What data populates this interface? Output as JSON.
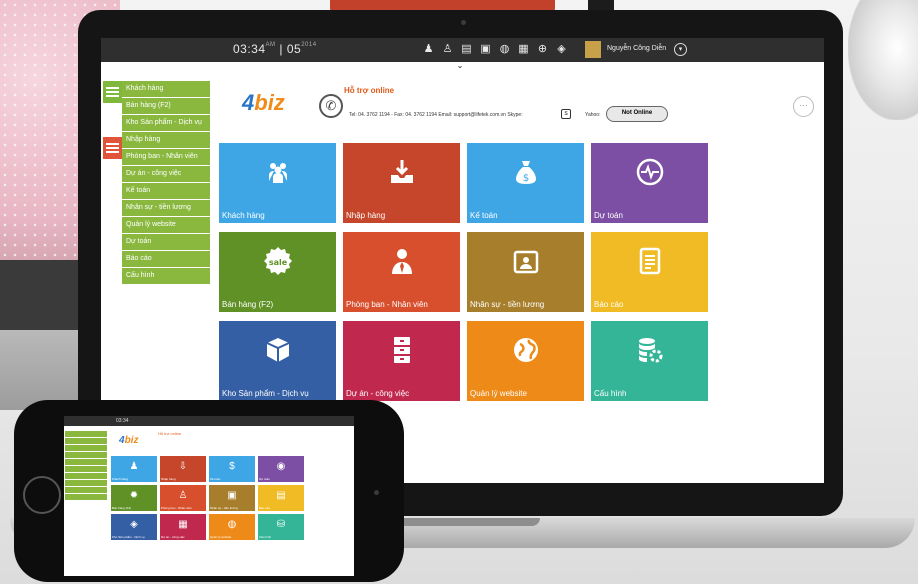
{
  "topbar": {
    "time": "03:34",
    "date_day": "05",
    "user_name": "Nguyễn Công Diễn"
  },
  "sidebar": {
    "items": [
      {
        "label": "Khách hàng"
      },
      {
        "label": "Bán hàng (F2)"
      },
      {
        "label": "Kho Sản phẩm - Dịch vụ"
      },
      {
        "label": "Nhập hàng"
      },
      {
        "label": "Phòng ban - Nhân viên"
      },
      {
        "label": "Dự án - công việc"
      },
      {
        "label": "Kế toán"
      },
      {
        "label": "Nhân sự - tiền lương"
      },
      {
        "label": "Quản lý website"
      },
      {
        "label": "Dự toán"
      },
      {
        "label": "Báo cáo"
      },
      {
        "label": "Cấu hình"
      }
    ]
  },
  "header": {
    "logo_left": "4",
    "logo_right": "biz",
    "support_title": "Hỗ trợ online",
    "contact": "Tel: 04. 3762 1194 - Fax: 04. 3762 1194   Email: support@lifetek.com.vn   Skype:",
    "yahoo_label": "Yahoo:",
    "yahoo_status": "Not Online"
  },
  "tiles": [
    {
      "label": "Khách hàng",
      "color": "#3fa6e6",
      "icon": "users-icon"
    },
    {
      "label": "Nhập hàng",
      "color": "#c5462a",
      "icon": "import-icon"
    },
    {
      "label": "Kế toán",
      "color": "#3fa6e6",
      "icon": "money-bag-icon"
    },
    {
      "label": "Dự toán",
      "color": "#7d4fa4",
      "icon": "pulse-icon"
    },
    {
      "label": "Bán hàng (F2)",
      "color": "#5f9127",
      "icon": "sale-icon"
    },
    {
      "label": "Phòng ban - Nhân viên",
      "color": "#d84f2d",
      "icon": "employee-icon"
    },
    {
      "label": "Nhân sự - tiền lương",
      "color": "#a77f2c",
      "icon": "id-card-icon"
    },
    {
      "label": "Báo cáo",
      "color": "#f0bb25",
      "icon": "report-icon"
    },
    {
      "label": "Kho Sản phẩm - Dịch vụ",
      "color": "#345fa4",
      "icon": "box-icon"
    },
    {
      "label": "Dự án - công việc",
      "color": "#c0284e",
      "icon": "cabinet-icon"
    },
    {
      "label": "Quản lý website",
      "color": "#ee8a18",
      "icon": "globe-icon"
    },
    {
      "label": "Cấu hình",
      "color": "#35b597",
      "icon": "database-gear-icon"
    }
  ]
}
